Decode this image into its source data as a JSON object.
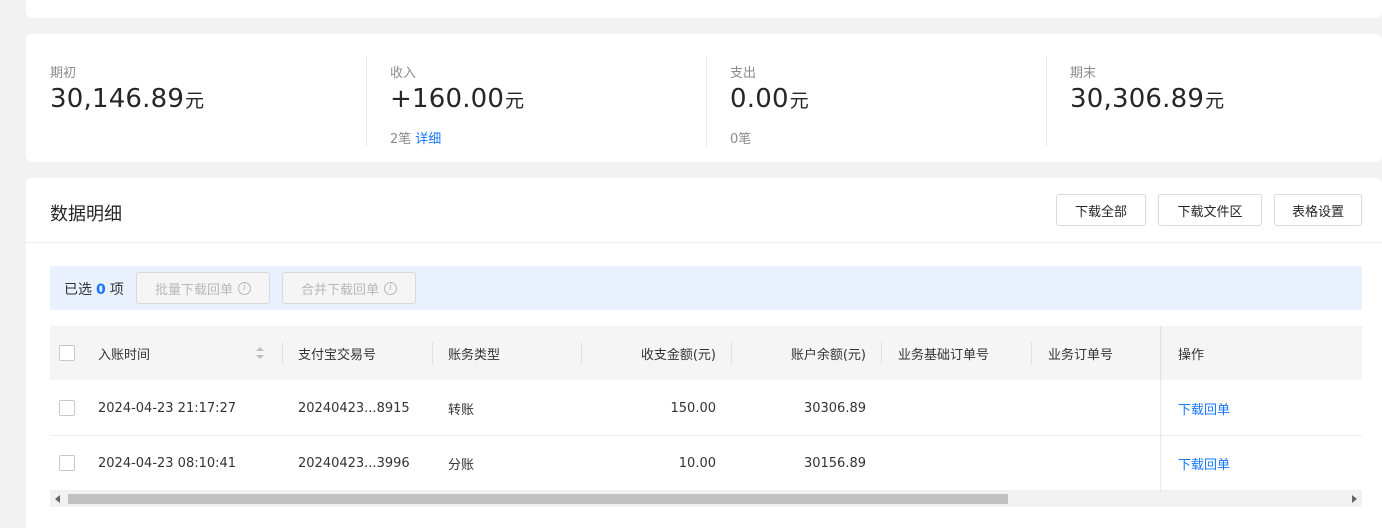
{
  "summary": {
    "opening": {
      "label": "期初",
      "value": "30,146.89",
      "unit": "元"
    },
    "income": {
      "label": "收入",
      "value": "+160.00",
      "unit": "元",
      "count": "2笔",
      "detail_link": "详细"
    },
    "expense": {
      "label": "支出",
      "value": "0.00",
      "unit": "元",
      "count": "0笔"
    },
    "closing": {
      "label": "期末",
      "value": "30,306.89",
      "unit": "元"
    }
  },
  "detail": {
    "title": "数据明细",
    "buttons": {
      "download_all": "下载全部",
      "download_area": "下载文件区",
      "table_settings": "表格设置"
    }
  },
  "selection": {
    "prefix": "已选",
    "count": "0",
    "suffix": "项",
    "batch_download": "批量下载回单",
    "merge_download": "合并下载回单",
    "info_icon": "i"
  },
  "table": {
    "columns": [
      "入账时间",
      "支付宝交易号",
      "账务类型",
      "收支金额(元)",
      "账户余额(元)",
      "业务基础订单号",
      "业务订单号",
      "操作"
    ],
    "rows": [
      {
        "time": "2024-04-23 21:17:27",
        "trade_no": "20240423...8915",
        "type": "转账",
        "amount": "150.00",
        "balance": "30306.89",
        "base_order": "",
        "order": "",
        "action": "下载回单"
      },
      {
        "time": "2024-04-23 08:10:41",
        "trade_no": "20240423...3996",
        "type": "分账",
        "amount": "10.00",
        "balance": "30156.89",
        "base_order": "",
        "order": "",
        "action": "下载回单"
      }
    ]
  },
  "icons": {
    "sort": "sort-icon",
    "info": "info-icon",
    "scroll_left": "scroll-left-arrow-icon",
    "scroll_right": "scroll-right-arrow-icon"
  },
  "colors": {
    "accent": "#1677ff",
    "select_bar_bg": "#e8f1fd",
    "page_bg": "#f2f2f2"
  }
}
